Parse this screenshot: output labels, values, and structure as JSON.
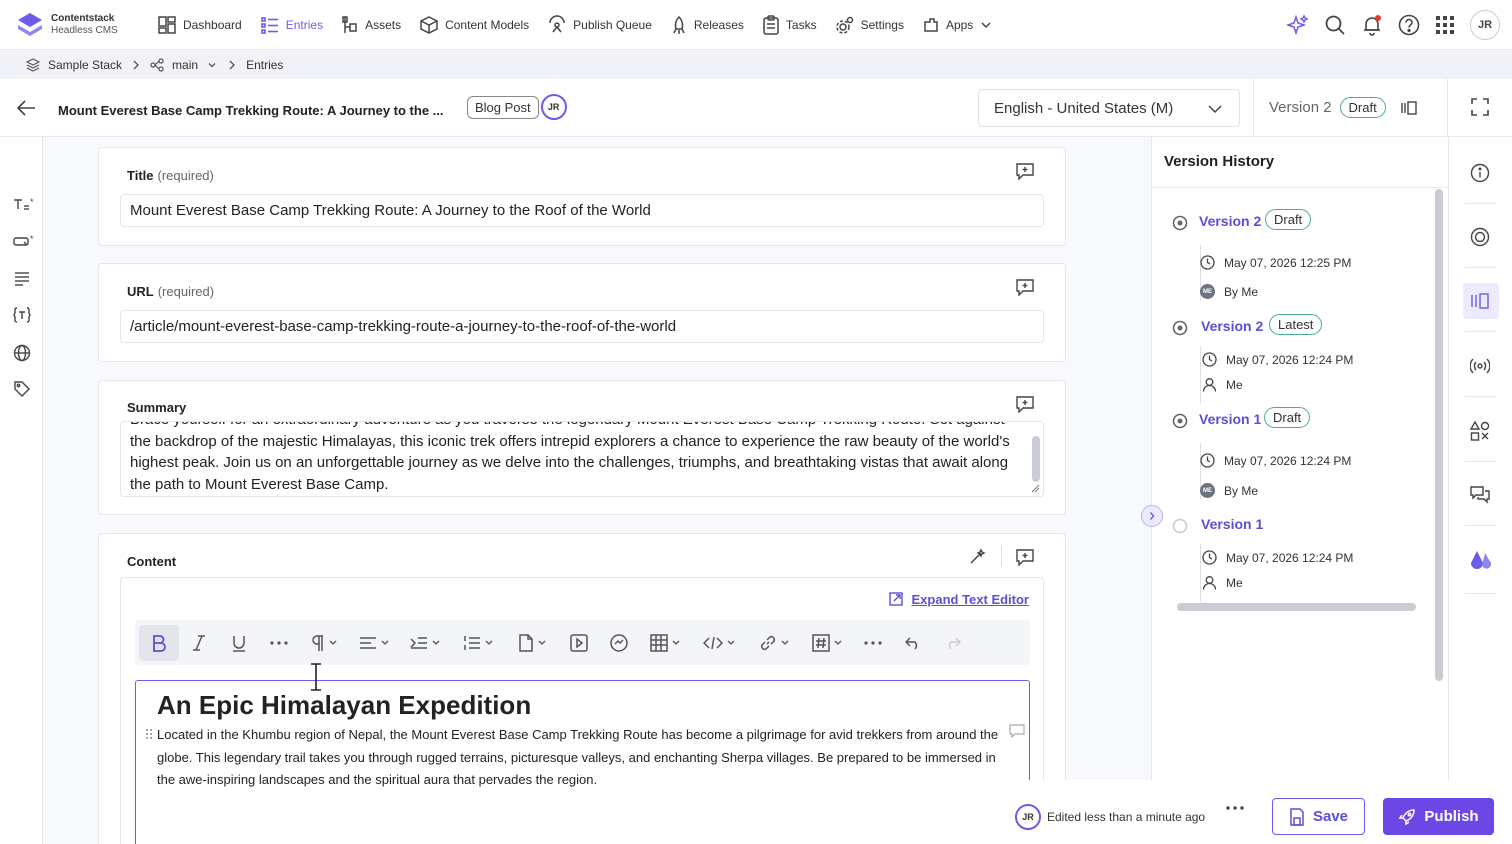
{
  "brand": {
    "name": "Contentstack",
    "subtitle": "Headless CMS"
  },
  "nav": [
    {
      "label": "Dashboard",
      "icon": "dashboard-icon"
    },
    {
      "label": "Entries",
      "icon": "entries-icon"
    },
    {
      "label": "Assets",
      "icon": "assets-icon"
    },
    {
      "label": "Content Models",
      "icon": "cube-icon"
    },
    {
      "label": "Publish Queue",
      "icon": "publish-queue-icon"
    },
    {
      "label": "Releases",
      "icon": "rocket-icon"
    },
    {
      "label": "Tasks",
      "icon": "clipboard-icon"
    },
    {
      "label": "Settings",
      "icon": "gear-icon"
    },
    {
      "label": "Apps",
      "icon": "apps-icon"
    }
  ],
  "user_initials": "JR",
  "breadcrumb": {
    "stack": "Sample Stack",
    "branch": "main",
    "section": "Entries"
  },
  "entry": {
    "title": "Mount Everest Base Camp Trekking Route: A Journey to the ...",
    "content_type": "Blog Post",
    "locale": "English - United States (M)",
    "version": "Version 2",
    "status": "Draft"
  },
  "fields": {
    "title": {
      "label": "Title",
      "required": "(required)",
      "value": "Mount Everest Base Camp Trekking Route: A Journey to the Roof of the World"
    },
    "url": {
      "label": "URL",
      "required": "(required)",
      "value": "/article/mount-everest-base-camp-trekking-route-a-journey-to-the-roof-of-the-world"
    },
    "summary": {
      "label": "Summary",
      "value": "Brace yourself for an extraordinary adventure as you traverse the legendary Mount Everest Base Camp Trekking Route. Set against the backdrop of the majestic Himalayas, this iconic trek offers intrepid explorers a chance to experience the raw beauty of the world's highest peak. Join us on an unforgettable journey as we delve into the challenges, triumphs, and breathtaking vistas that await along the path to Mount Everest Base Camp."
    },
    "content": {
      "label": "Content",
      "expand_label": "Expand Text Editor",
      "heading": "An Epic Himalayan Expedition",
      "paragraph": "Located in the Khumbu region of Nepal, the Mount Everest Base Camp Trekking Route has become a pilgrimage for avid trekkers from around the globe. This legendary trail takes you through rugged terrains, picturesque valleys, and enchanting Sherpa villages. Be prepared to be immersed in the awe-inspiring landscapes and the spiritual aura that pervades the region."
    }
  },
  "version_history": {
    "title": "Version History",
    "items": [
      {
        "name": "Version 2",
        "badge": "Draft",
        "date": "May 07, 2026 12:25 PM",
        "by": "By Me",
        "author_style": "avatar"
      },
      {
        "name": "Version 2",
        "badge": "Latest",
        "date": "May 07, 2026 12:24 PM",
        "by": "Me",
        "author_style": "person"
      },
      {
        "name": "Version 1",
        "badge": "Draft",
        "date": "May 07, 2026 12:24 PM",
        "by": "By Me",
        "author_style": "avatar"
      },
      {
        "name": "Version 1",
        "badge": "",
        "date": "May 07, 2026 12:24 PM",
        "by": "Me",
        "author_style": "person"
      }
    ],
    "me_initials": "ME"
  },
  "footer": {
    "edited": "Edited less than a minute ago",
    "save": "Save",
    "publish": "Publish"
  },
  "colors": {
    "accent": "#6c5ce7",
    "publish": "#6c47e6",
    "badge_border": "#4caf82"
  }
}
